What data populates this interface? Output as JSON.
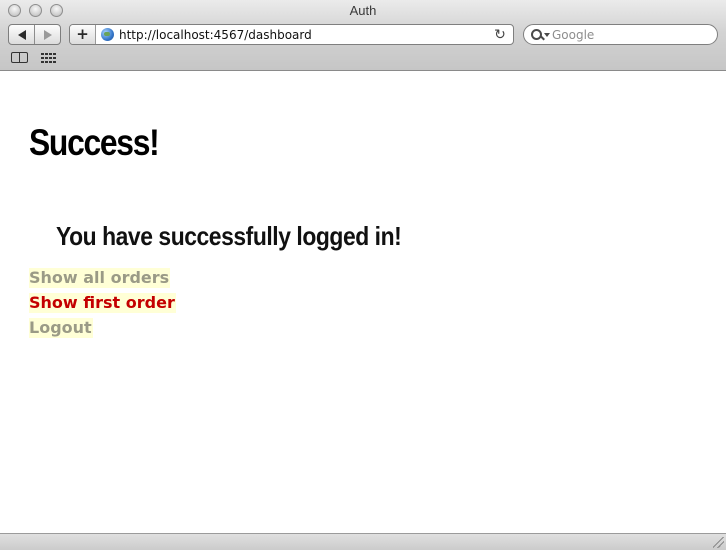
{
  "window": {
    "title": "Auth"
  },
  "toolbar": {
    "back_icon": "back-arrow-icon",
    "forward_icon": "forward-arrow-icon",
    "add_bookmark_label": "+",
    "address_url": "http://localhost:4567/dashboard",
    "reload_glyph": "↻",
    "search_placeholder": "Google"
  },
  "bookmarks_bar": {
    "icons": [
      "bookmarks-book-icon",
      "top-sites-grid-icon"
    ]
  },
  "page": {
    "title": "Success!",
    "message": "You have successfully logged in!",
    "links": [
      {
        "label": "Show all orders",
        "state": "visited"
      },
      {
        "label": "Show first order",
        "state": "active"
      },
      {
        "label": "Logout",
        "state": "visited"
      }
    ]
  },
  "colors": {
    "link_visited": "#9a9a86",
    "link_active": "#c40000",
    "link_highlight": "#ffffd6"
  }
}
